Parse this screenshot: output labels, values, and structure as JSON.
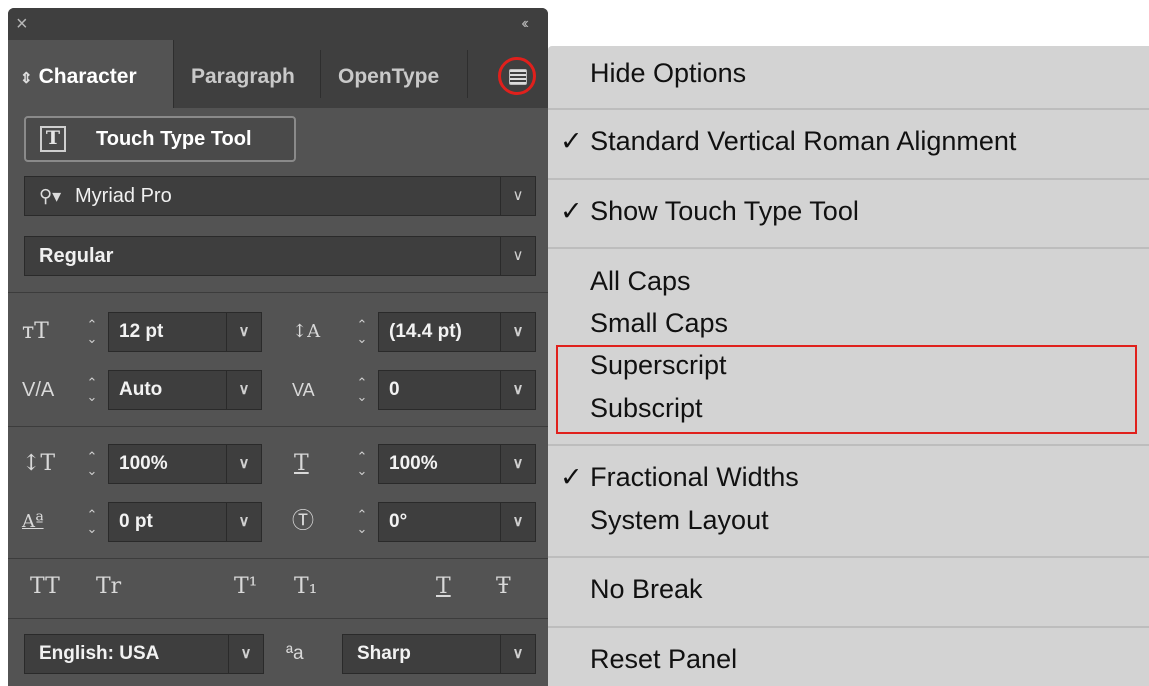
{
  "panel": {
    "close_glyph": "×",
    "collapse_glyph": "‹‹",
    "tabs": [
      {
        "label": "Character",
        "active": true
      },
      {
        "label": "Paragraph"
      },
      {
        "label": "OpenType"
      }
    ],
    "touch_type_button": "Touch Type Tool",
    "font_family": "Myriad Pro",
    "font_style": "Regular",
    "fields": {
      "font_size": "12 pt",
      "leading": "(14.4 pt)",
      "kerning": "Auto",
      "tracking": "0",
      "vertical_scale": "100%",
      "horizontal_scale": "100%",
      "baseline_shift": "0 pt",
      "rotation": "0°"
    },
    "style_buttons": [
      "TT",
      "Tr",
      "T¹",
      "T₁",
      "T",
      "Ŧ"
    ],
    "language": "English: USA",
    "antialias_icon_text": "ªa",
    "antialias": "Sharp",
    "accent_color": "#e0201c"
  },
  "menu": {
    "items": [
      {
        "label": "Hide Options"
      },
      {
        "label": "Standard Vertical Roman Alignment",
        "checked": true
      },
      {
        "label": "Show Touch Type Tool",
        "checked": true
      },
      {
        "label": "All Caps"
      },
      {
        "label": "Small Caps"
      },
      {
        "label": "Superscript"
      },
      {
        "label": "Subscript"
      },
      {
        "label": "Fractional Widths",
        "checked": true
      },
      {
        "label": "System Layout"
      },
      {
        "label": "No Break"
      },
      {
        "label": "Reset Panel"
      }
    ],
    "check_glyph": "✓"
  }
}
